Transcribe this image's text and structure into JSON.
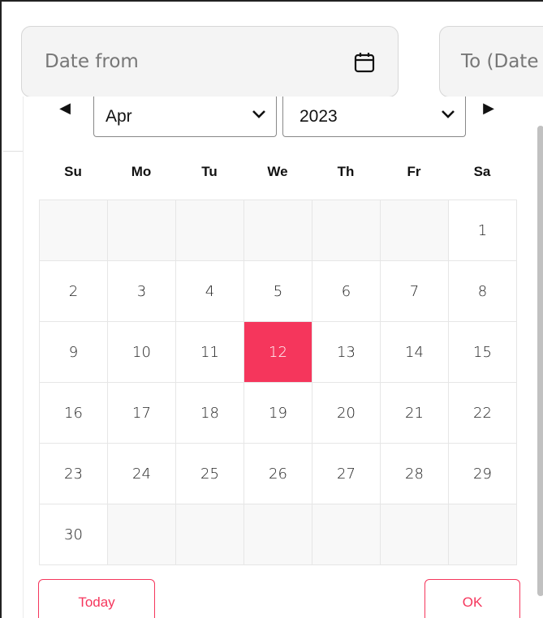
{
  "fields": {
    "from_placeholder": "Date from",
    "to_placeholder": "To (Date"
  },
  "picker": {
    "prev_arrow": "◀",
    "next_arrow": "▶",
    "month_value": "Apr",
    "year_value": "2023",
    "weekdays": [
      "Su",
      "Mo",
      "Tu",
      "We",
      "Th",
      "Fr",
      "Sa"
    ],
    "weeks": [
      [
        "",
        "",
        "",
        "",
        "",
        "",
        "1"
      ],
      [
        "2",
        "3",
        "4",
        "5",
        "6",
        "7",
        "8"
      ],
      [
        "9",
        "10",
        "11",
        "12",
        "13",
        "14",
        "15"
      ],
      [
        "16",
        "17",
        "18",
        "19",
        "20",
        "21",
        "22"
      ],
      [
        "23",
        "24",
        "25",
        "26",
        "27",
        "28",
        "29"
      ],
      [
        "30",
        "",
        "",
        "",
        "",
        "",
        ""
      ]
    ],
    "selected_day": "12",
    "today_label": "Today",
    "ok_label": "OK"
  },
  "colors": {
    "accent": "#f5365c",
    "field_bg": "#f4f4f4",
    "empty_cell_bg": "#f8f8f8"
  },
  "icons": {
    "date_from": "calendar-icon",
    "select": "chevron-down-icon"
  }
}
